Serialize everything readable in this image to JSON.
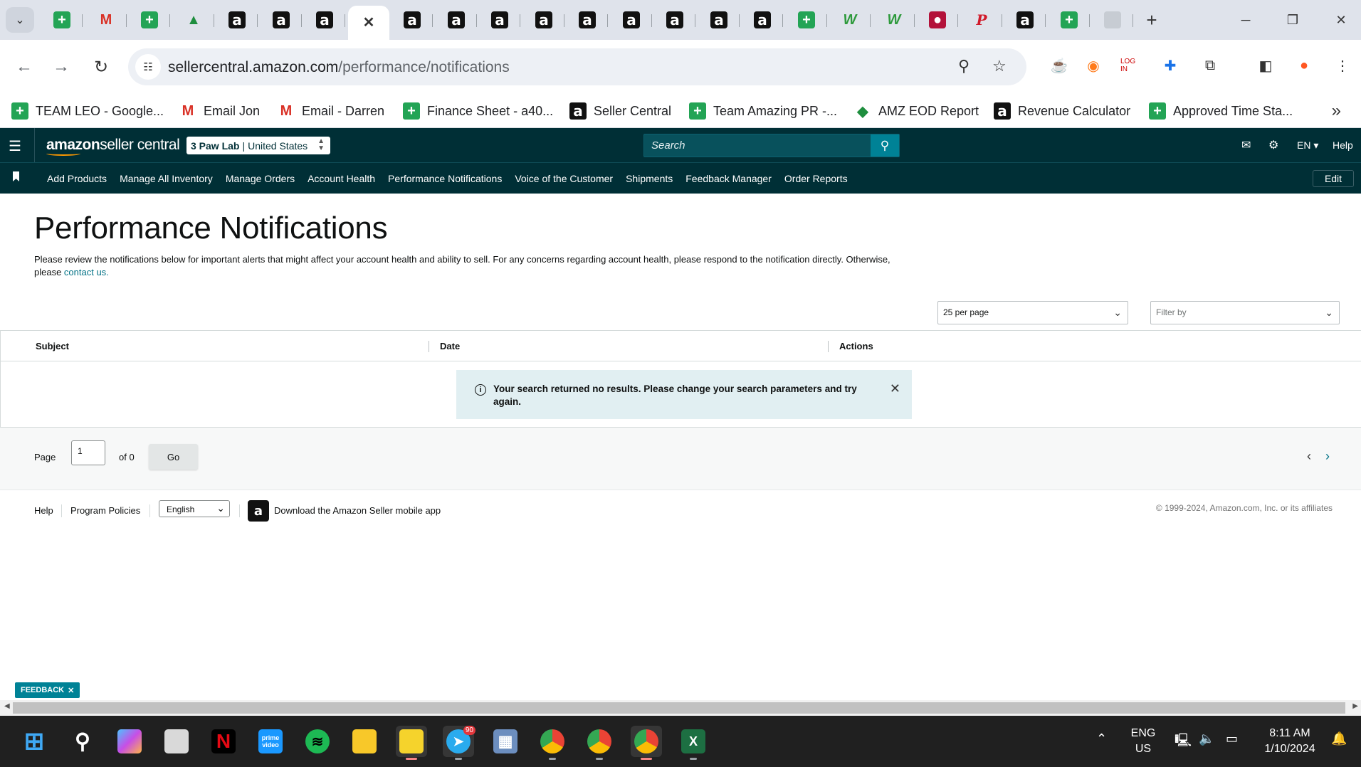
{
  "browser": {
    "tabs": [
      {
        "icon": "sheets-icon",
        "glyph": "+",
        "style": "plus"
      },
      {
        "icon": "gmail-icon",
        "glyph": "M",
        "style": "gmail"
      },
      {
        "icon": "sheets-icon",
        "glyph": "+",
        "style": "plus"
      },
      {
        "icon": "drive-icon",
        "glyph": "▲",
        "style": "drive"
      },
      {
        "icon": "amazon-icon",
        "glyph": "a",
        "style": "amz"
      },
      {
        "icon": "amazon-icon",
        "glyph": "a",
        "style": "amz"
      },
      {
        "icon": "amazon-icon",
        "glyph": "a",
        "style": "amz"
      },
      {
        "icon": "close-icon",
        "glyph": "✕",
        "style": "close",
        "active": true
      },
      {
        "icon": "amazon-icon",
        "glyph": "a",
        "style": "amz"
      },
      {
        "icon": "amazon-icon",
        "glyph": "a",
        "style": "amz"
      },
      {
        "icon": "amazon-icon",
        "glyph": "a",
        "style": "amz"
      },
      {
        "icon": "amazon-icon",
        "glyph": "a",
        "style": "amz"
      },
      {
        "icon": "amazon-icon",
        "glyph": "a",
        "style": "amz"
      },
      {
        "icon": "amazon-icon",
        "glyph": "a",
        "style": "amz"
      },
      {
        "icon": "amazon-icon",
        "glyph": "a",
        "style": "amz"
      },
      {
        "icon": "amazon-icon",
        "glyph": "a",
        "style": "amz"
      },
      {
        "icon": "amazon-icon",
        "glyph": "a",
        "style": "amz"
      },
      {
        "icon": "sheets-icon",
        "glyph": "+",
        "style": "plus"
      },
      {
        "icon": "w-app-icon",
        "glyph": "W",
        "style": "w"
      },
      {
        "icon": "w-app-icon",
        "glyph": "W",
        "style": "w"
      },
      {
        "icon": "red-circle-icon",
        "glyph": "●",
        "style": "red"
      },
      {
        "icon": "pinterest-icon",
        "glyph": "P",
        "style": "p"
      },
      {
        "icon": "amazon-icon",
        "glyph": "a",
        "style": "amz"
      },
      {
        "icon": "sheets-icon",
        "glyph": "+",
        "style": "plus"
      },
      {
        "icon": "globe-icon",
        "glyph": "",
        "style": "grey"
      }
    ],
    "url_host": "sellercentral.amazon.com",
    "url_path": "/performance/notifications",
    "bookmarks": [
      {
        "label": "TEAM LEO - Google...",
        "icon": "sheets-icon",
        "glyph": "+",
        "style": "plus"
      },
      {
        "label": "Email Jon",
        "icon": "gmail-icon",
        "glyph": "M",
        "style": "gmail"
      },
      {
        "label": "Email - Darren",
        "icon": "gmail-icon",
        "glyph": "M",
        "style": "gmail"
      },
      {
        "label": "Finance Sheet - a40...",
        "icon": "sheets-icon",
        "glyph": "+",
        "style": "plus"
      },
      {
        "label": "Seller Central",
        "icon": "amazon-icon",
        "glyph": "a",
        "style": "amz"
      },
      {
        "label": "Team Amazing PR -...",
        "icon": "sheets-icon",
        "glyph": "+",
        "style": "plus"
      },
      {
        "label": "AMZ EOD Report",
        "icon": "report-icon",
        "glyph": "◆",
        "style": "drive"
      },
      {
        "label": "Revenue Calculator",
        "icon": "amazon-icon",
        "glyph": "a",
        "style": "amz"
      },
      {
        "label": "Approved Time Sta...",
        "icon": "sheets-icon",
        "glyph": "+",
        "style": "plus"
      }
    ]
  },
  "header": {
    "logo_bold": "amazon",
    "logo_rest": " seller central",
    "account_name": "3 Paw Lab",
    "account_region": "United States",
    "search_placeholder": "Search",
    "language": "EN ▾",
    "help": "Help"
  },
  "nav": {
    "links": [
      "Add Products",
      "Manage All Inventory",
      "Manage Orders",
      "Account Health",
      "Performance Notifications",
      "Voice of the Customer",
      "Shipments",
      "Feedback Manager",
      "Order Reports"
    ],
    "edit": "Edit"
  },
  "page": {
    "title": "Performance Notifications",
    "intro": "Please review the notifications below for important alerts that might affect your account health and ability to sell. For any concerns regarding account health, please respond to the notification directly. Otherwise, please ",
    "contact_link": "contact us.",
    "per_page": "25 per page",
    "filter_placeholder": "Filter by",
    "columns": [
      "Subject",
      "Date",
      "Actions"
    ],
    "alert_message": "Your search returned no results. Please change your search parameters and try again.",
    "pager_label": "Page",
    "pager_value": "1",
    "pager_of": "of 0",
    "go": "Go"
  },
  "footer": {
    "help": "Help",
    "program_policies": "Program Policies",
    "language": "English",
    "app_link": "Download the Amazon Seller mobile app",
    "copyright": "© 1999-2024, Amazon.com, Inc. or its affiliates"
  },
  "feedback": "FEEDBACK",
  "taskbar": {
    "language_line1": "ENG",
    "language_line2": "US",
    "time": "8:11 AM",
    "date": "1/10/2024",
    "telegram_badge": "90"
  },
  "colors": {
    "header_bg": "#002f36",
    "accent_teal": "#008296",
    "alert_bg": "#e1eff2"
  }
}
